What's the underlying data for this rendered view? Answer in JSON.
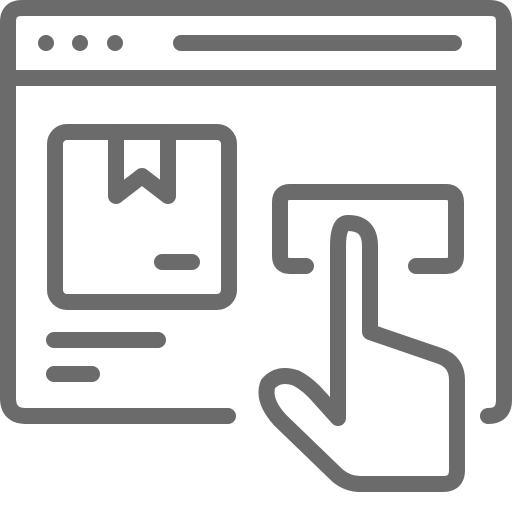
{
  "icon": {
    "name": "online-order-click-icon",
    "stroke_color": "#6b6b6b",
    "parts": [
      "browser-window-icon",
      "window-dots-icon",
      "address-bar-icon",
      "package-box-icon",
      "box-tape-icon",
      "box-label-icon",
      "product-text-lines-icon",
      "buy-button-icon",
      "pointing-hand-icon"
    ]
  }
}
